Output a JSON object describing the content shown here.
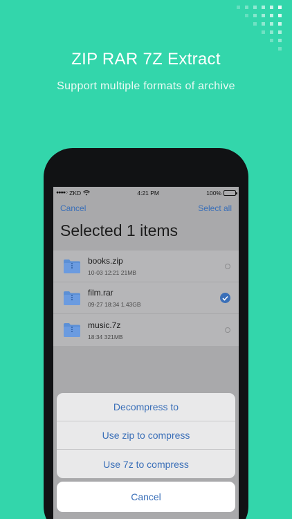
{
  "promo": {
    "headline": "ZIP RAR 7Z Extract",
    "subline": "Support multiple formats of archive"
  },
  "status_bar": {
    "signal": "●●●●○",
    "carrier": "ZKD",
    "wifi_icon": "wifi-icon",
    "time": "4:21 PM",
    "battery": "100%"
  },
  "nav": {
    "cancel": "Cancel",
    "select_all": "Select all"
  },
  "title": "Selected 1 items",
  "files": [
    {
      "name": "books.zip",
      "meta": "10-03 12:21 21MB",
      "selected": false
    },
    {
      "name": "film.rar",
      "meta": "09-27 18:34 1.43GB",
      "selected": true
    },
    {
      "name": "music.7z",
      "meta": "18:34 321MB",
      "selected": false
    }
  ],
  "action_sheet": {
    "options": [
      "Decompress to",
      "Use zip to compress",
      "Use 7z to compress"
    ],
    "cancel": "Cancel"
  },
  "colors": {
    "background": "#33d6ab",
    "accent": "#3a6fb8",
    "folder": "#5b8fd6"
  }
}
